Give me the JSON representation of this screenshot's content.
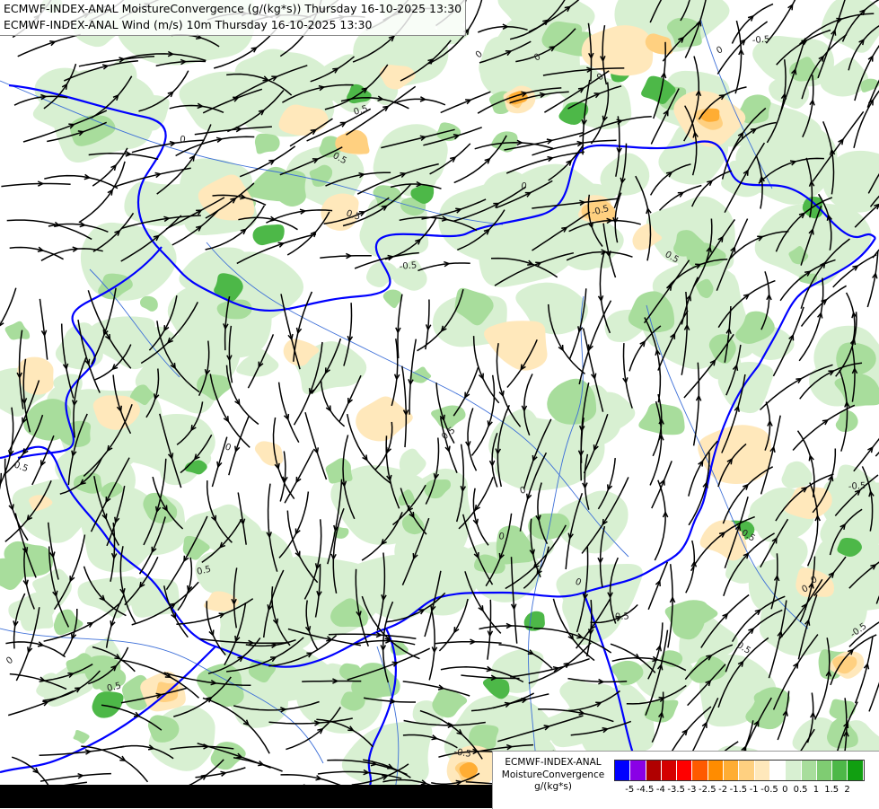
{
  "titles": {
    "line1": "ECMWF-INDEX-ANAL MoistureConvergence (g/(kg*s)) Thursday 16-10-2025 13:30",
    "line2": "ECMWF-INDEX-ANAL Wind (m/s) 10m Thursday 16-10-2025 13:30"
  },
  "legend": {
    "line1": "ECMWF-INDEX-ANAL",
    "line2": "MoistureConvergence",
    "line3": "g/(kg*s)",
    "colors": [
      "#0000ff",
      "#8a00e6",
      "#b00000",
      "#d40000",
      "#ff0000",
      "#ff5a00",
      "#ff8c00",
      "#ffad33",
      "#ffd080",
      "#ffe8bb",
      "#ffffff",
      "#d8f0d2",
      "#a8dd9c",
      "#7fcc72",
      "#4db848",
      "#119f11"
    ],
    "tick_labels": [
      "-5",
      "-4.5",
      "-4",
      "-3.5",
      "-3",
      "-2.5",
      "-2",
      "-1.5",
      "-1",
      "-0.5",
      "0",
      "0.5",
      "1",
      "1.5",
      "2"
    ]
  },
  "map_colors": {
    "border": "#0000ff",
    "river": "#3d6fd8",
    "streamline": "#000000",
    "convergence_light": "#d8f0d2",
    "convergence_mid": "#a8dd9c",
    "convergence_strong": "#4db848",
    "divergence_light": "#ffe8bb",
    "divergence_mid": "#ffd080",
    "divergence_strong": "#ffad33"
  },
  "contour_labels": [
    "0",
    "0.5",
    "0",
    "0.5",
    "0",
    "-0.5",
    "0.5",
    "0",
    "-0.5",
    "0",
    "0.5",
    "0",
    "-0.5",
    "0",
    "0.5",
    "0",
    "0",
    "0.5",
    "0",
    "-0.5",
    "0.5",
    "0",
    "0.5",
    "-0.5",
    "0.5",
    "0",
    "0.5",
    "0",
    "-0.5",
    "0.5"
  ]
}
